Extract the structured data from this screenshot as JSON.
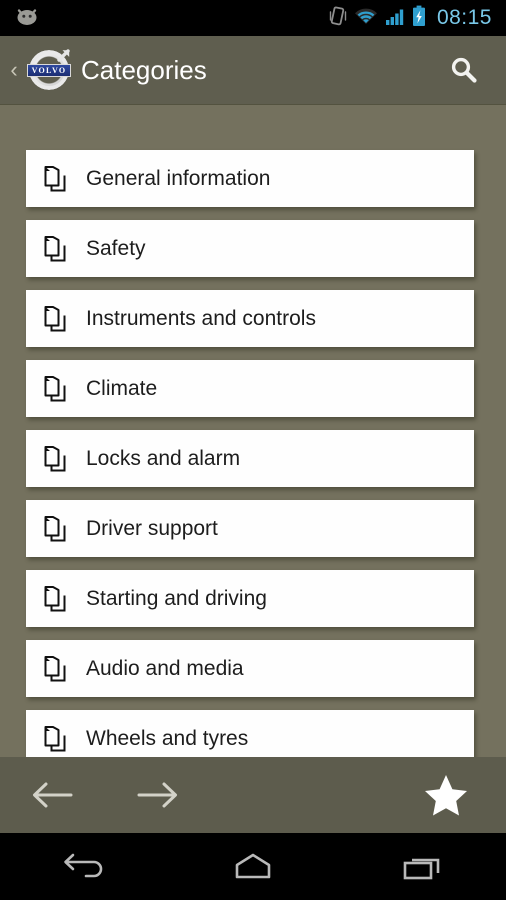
{
  "statusbar": {
    "mascot_icon": "android-mascot-icon",
    "vibrate_icon": "vibrate-icon",
    "wifi_icon": "wifi-icon",
    "signal_icon": "cellular-signal-icon",
    "battery_icon": "battery-charging-icon",
    "time": "08:15",
    "accent_color": "#79c8e8",
    "background_color": "#000000"
  },
  "actionbar": {
    "back_chevron": "‹",
    "logo_name": "volvo-logo",
    "logo_wordmark": "VOLVO",
    "title": "Categories",
    "search_icon": "search-icon",
    "background_color": "#5f5e4f",
    "title_color": "#ffffff"
  },
  "page": {
    "background_color": "#74715e"
  },
  "list": {
    "item_icon": "documents-icon",
    "items": [
      {
        "label": "General information"
      },
      {
        "label": "Safety"
      },
      {
        "label": "Instruments and controls"
      },
      {
        "label": "Climate"
      },
      {
        "label": "Locks and alarm"
      },
      {
        "label": "Driver support"
      },
      {
        "label": "Starting and driving"
      },
      {
        "label": "Audio and media"
      },
      {
        "label": "Wheels and tyres"
      }
    ]
  },
  "toolbar": {
    "back_icon": "arrow-left-icon",
    "forward_icon": "arrow-right-icon",
    "favorite_icon": "star-icon",
    "background_color": "#5d5c4d"
  },
  "navbar": {
    "back_icon": "android-back-icon",
    "home_icon": "android-home-icon",
    "recents_icon": "android-recents-icon",
    "background_color": "#000000"
  }
}
